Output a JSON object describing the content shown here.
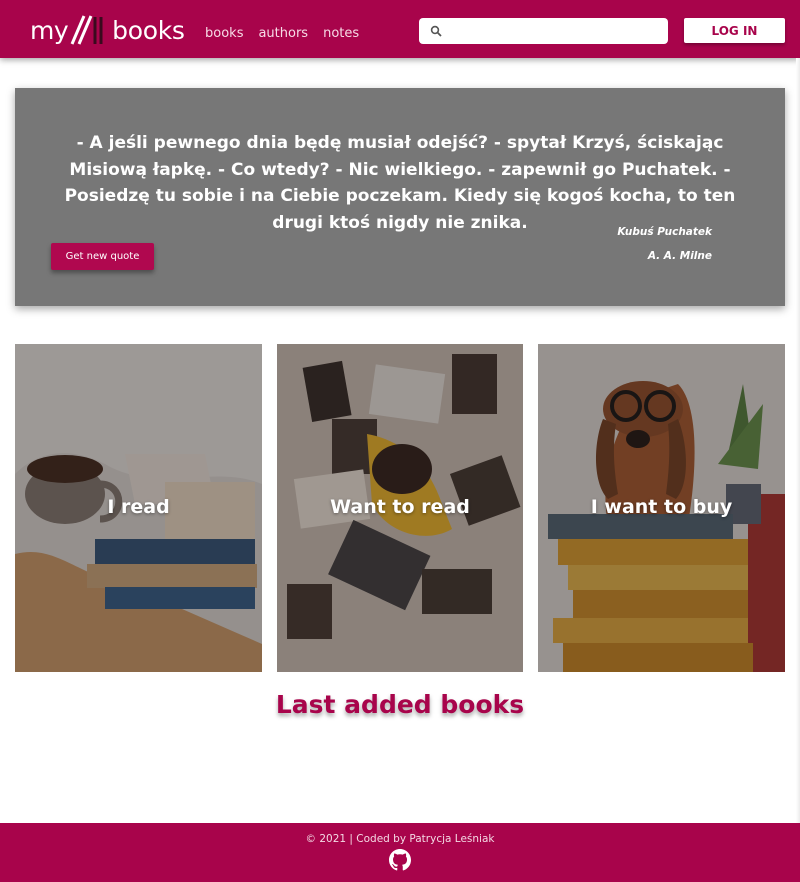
{
  "header": {
    "logo_my": "my",
    "logo_books": "books",
    "nav": [
      "books",
      "authors",
      "notes"
    ],
    "search_placeholder": "",
    "search_value": "",
    "login_label": "LOG IN"
  },
  "quote": {
    "text": "- A jeśli pewnego dnia będę musiał odejść? - spytał Krzyś, ściskając Misiową łapkę. - Co wtedy? - Nic wielkiego. - zapewnił go Puchatek. - Posiedzę tu sobie i na Ciebie poczekam. Kiedy się kogoś kocha, to ten drugi ktoś nigdy nie znika.",
    "source": "Kubuś Puchatek",
    "author": "A. A. Milne",
    "button_label": "Get new quote"
  },
  "categories": [
    {
      "label": "I read"
    },
    {
      "label": "Want to read"
    },
    {
      "label": "I want to buy"
    }
  ],
  "last_added_title": "Last added books",
  "footer": {
    "credit": "© 2021 | Coded by Patrycja Leśniak",
    "icon": "github-icon"
  },
  "colors": {
    "brand": "#a8044b",
    "quote_bg": "#777777",
    "button": "#b0084f"
  }
}
